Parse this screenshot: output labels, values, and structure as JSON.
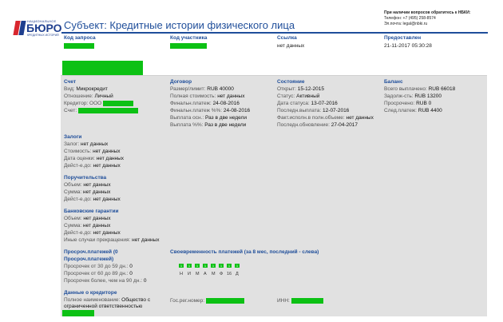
{
  "logo": {
    "line1": "НАЦИОНАЛЬНОЕ",
    "brand": "БЮРО",
    "line2": "КРЕДИТНЫХ ИСТОРИЙ"
  },
  "title": "Субъект: Кредитные истории физического лица",
  "contact": {
    "title": "При наличии вопросов обратитесь к НБКИ:",
    "phone": "Телефон: +7 (495) 258-8574",
    "email": "Эл.почта: legal@nbki.ru"
  },
  "header": {
    "request_code_label": "Код запроса",
    "member_code_label": "Код участника",
    "link_label": "Ссылка",
    "link_value": "нет данных",
    "provided_label": "Предоставлен",
    "provided_value": "21-11-2017 05:30:28"
  },
  "account": {
    "title": "Счет",
    "kind_label": "Вид:",
    "kind_value": "Микрокредит",
    "relation_label": "Отношение:",
    "relation_value": "Личный",
    "creditor_label": "Кредитор: ООО",
    "account_label": "Счет:"
  },
  "contract": {
    "title": "Договор",
    "limit_label": "Размер/лимит:",
    "limit_value": "RUB 40000",
    "full_cost_label": "Полная стоимость:",
    "full_cost_value": "нет данных",
    "final_payment_label": "Финальн.платеж:",
    "final_payment_value": "24-08-2016",
    "final_payment_pct_label": "Финальн.платеж %%:",
    "final_payment_pct_value": "24-08-2016",
    "payment_main_label": "Выплата осн.:",
    "payment_main_value": "Раз в две недели",
    "payment_pct_label": "Выплата %%:",
    "payment_pct_value": "Раз в две недели"
  },
  "state": {
    "title": "Состояние",
    "opened_label": "Открыт:",
    "opened_value": "15-12-2015",
    "status_label": "Статус:",
    "status_value": "Активный",
    "status_date_label": "Дата статуса:",
    "status_date_value": "13-07-2016",
    "last_payment_label": "Последн.выплата:",
    "last_payment_value": "12-07-2016",
    "actual_label": "Факт.исполн.в полн.объеме:",
    "actual_value": "нет данных",
    "last_update_label": "Последн.обновление:",
    "last_update_value": "27-04-2017"
  },
  "balance": {
    "title": "Баланс",
    "paid_label": "Всего выплачено:",
    "paid_value": "RUB 66018",
    "debt_label": "Задолж-сть:",
    "debt_value": "RUB 13200",
    "overdue_label": "Просрочено:",
    "overdue_value": "RUB 0",
    "next_label": "След.платеж:",
    "next_value": "RUB 4400"
  },
  "collateral": {
    "title": "Залоги",
    "pledge_label": "Залог:",
    "pledge_value": "нет данных",
    "cost_label": "Стоимость:",
    "cost_value": "нет данных",
    "date_label": "Дата оценки:",
    "date_value": "нет данных",
    "valid_label": "Дейст-е.до:",
    "valid_value": "нет данных"
  },
  "guarantees": {
    "title": "Поручительства",
    "volume_label": "Объем:",
    "volume_value": "нет данных",
    "sum_label": "Сумма:",
    "sum_value": "нет данных",
    "valid_label": "Дейст-е.до:",
    "valid_value": "нет данных"
  },
  "bank_guarantees": {
    "title": "Банковские гарантии",
    "volume_label": "Объем:",
    "volume_value": "нет данных",
    "sum_label": "Сумма:",
    "sum_value": "нет данных",
    "valid_label": "Дейст-е.до:",
    "valid_value": "нет данных",
    "other_label": "Иные случаи прекращения:",
    "other_value": "нет данных"
  },
  "overdue": {
    "title1": "Просроч.платежей (0",
    "title2": "Просроч.платежей)",
    "r1_label": "Просрочек от 30 до 59 дн.:",
    "r1_value": "0",
    "r2_label": "Просрочек от 60 до 89 дн.:",
    "r2_value": "0",
    "r3_label": "Просрочек более, чем на 90 дн.:",
    "r3_value": "0"
  },
  "timeliness": {
    "title": "Своевременность платежей (за 8 мес, последний - слева)",
    "months": [
      "Н",
      "И",
      "М",
      "А",
      "М",
      "Ф",
      "16",
      "Д"
    ]
  },
  "creditor_data": {
    "title": "Данные о кредиторе",
    "fullname_label": "Полное наименование:",
    "fullname_value1": "Общество с",
    "fullname_value2": "ограниченной ответственностью",
    "reg_label": "Гос.рег.номер:",
    "inn_label": "ИНН:"
  },
  "colors": {
    "accent": "#1f4e9a",
    "redact": "#0cc114",
    "panel": "#e1e1e1"
  }
}
